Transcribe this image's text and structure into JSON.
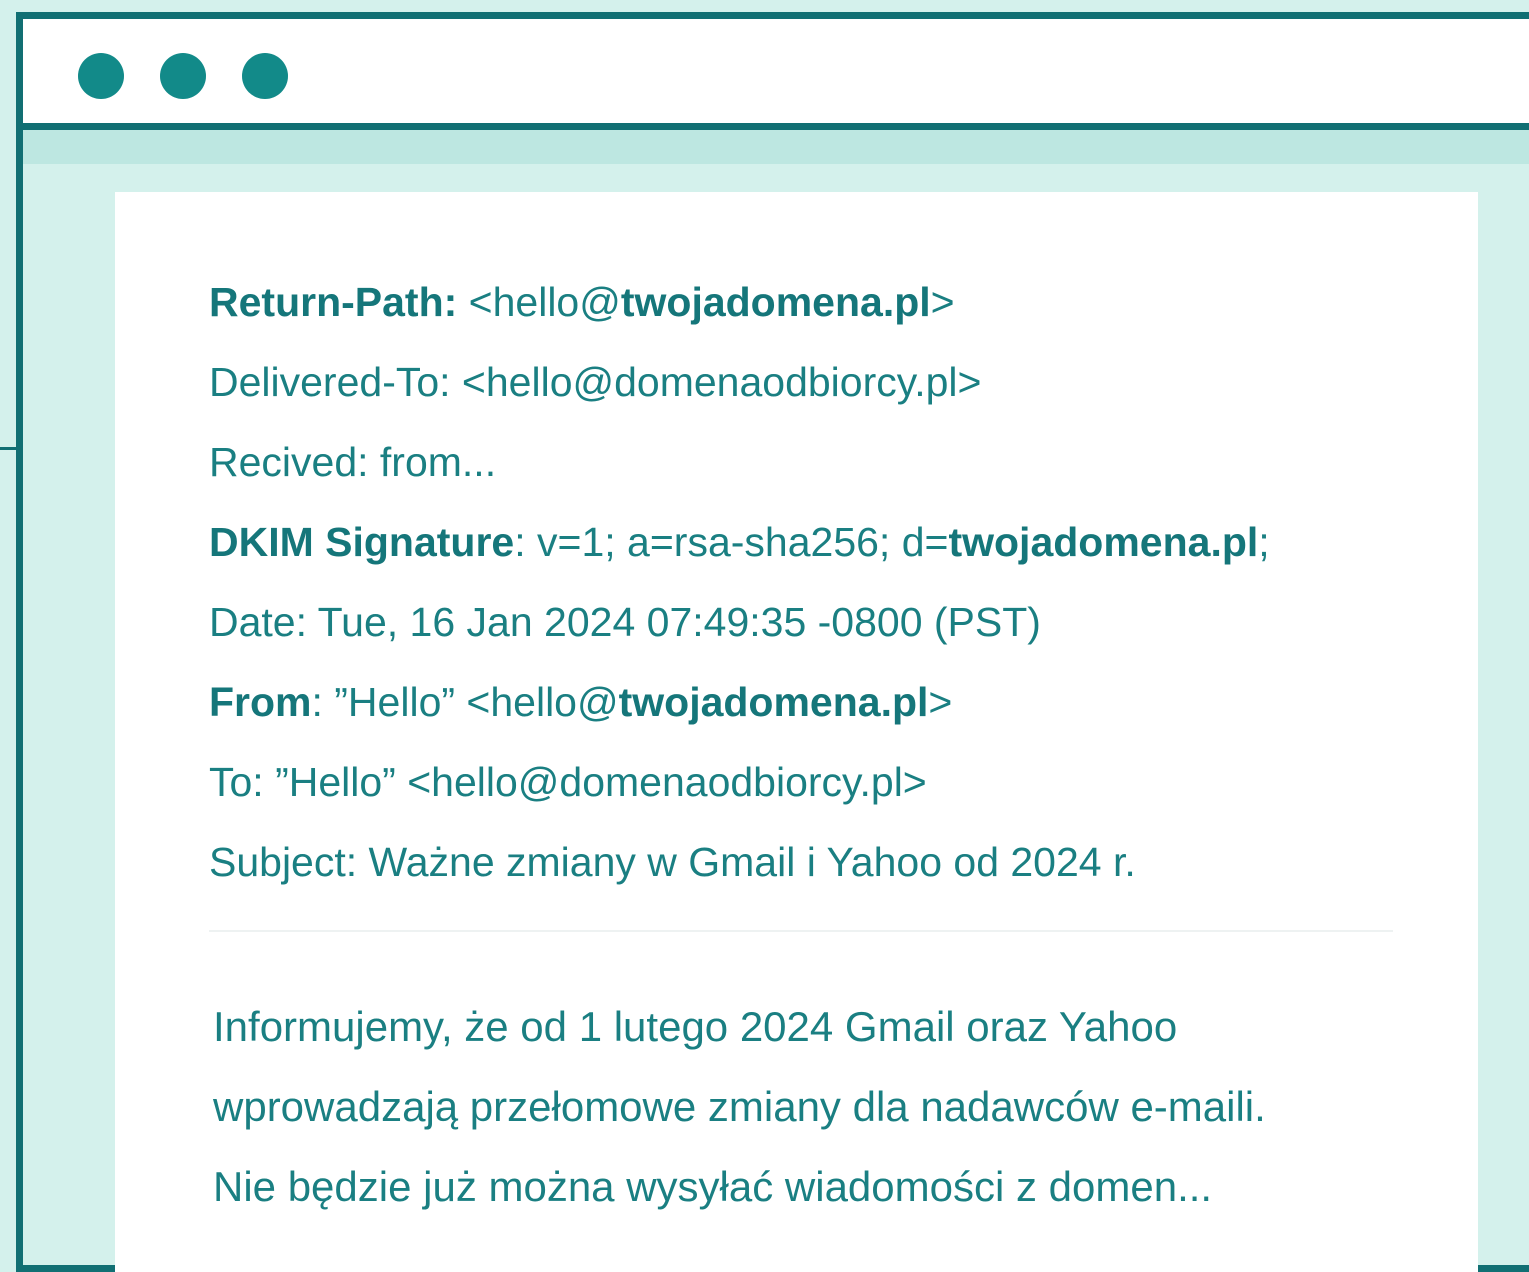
{
  "window": {
    "controls": [
      "dot-1",
      "dot-2",
      "dot-3"
    ]
  },
  "email": {
    "return_path": {
      "label": "Return-Path:",
      "prefix": " <hello@",
      "domain": "twojadomena.pl",
      "suffix": ">"
    },
    "delivered_to": {
      "text": "Delivered-To: <hello@domenaodbiorcy.pl>"
    },
    "received": {
      "text": "Recived: from..."
    },
    "dkim": {
      "label": "DKIM Signature",
      "middle": ": v=1; a=rsa-sha256; d=",
      "domain": "twojadomena.pl",
      "suffix": ";"
    },
    "date": {
      "text": "Date: Tue, 16 Jan 2024 07:49:35 -0800 (PST)"
    },
    "from": {
      "label": "From",
      "middle": ": ”Hello” <hello@",
      "domain": "twojadomena.pl",
      "suffix": ">"
    },
    "to": {
      "text": "To: ”Hello” <hello@domenaodbiorcy.pl>"
    },
    "subject": {
      "text": "Subject: Ważne zmiany w Gmail i Yahoo od 2024 r."
    },
    "body_lines": [
      "Informujemy, że od 1 lutego 2024 Gmail oraz Yahoo",
      "wprowadzają przełomowe zmiany dla nadawców e-maili.",
      "Nie będzie już można wysyłać wiadomości z domen..."
    ]
  },
  "colors": {
    "accent": "#116f73",
    "text": "#1a7f82",
    "background": "#d4f1ec",
    "band": "#bde7e1",
    "dot": "#128a89"
  }
}
